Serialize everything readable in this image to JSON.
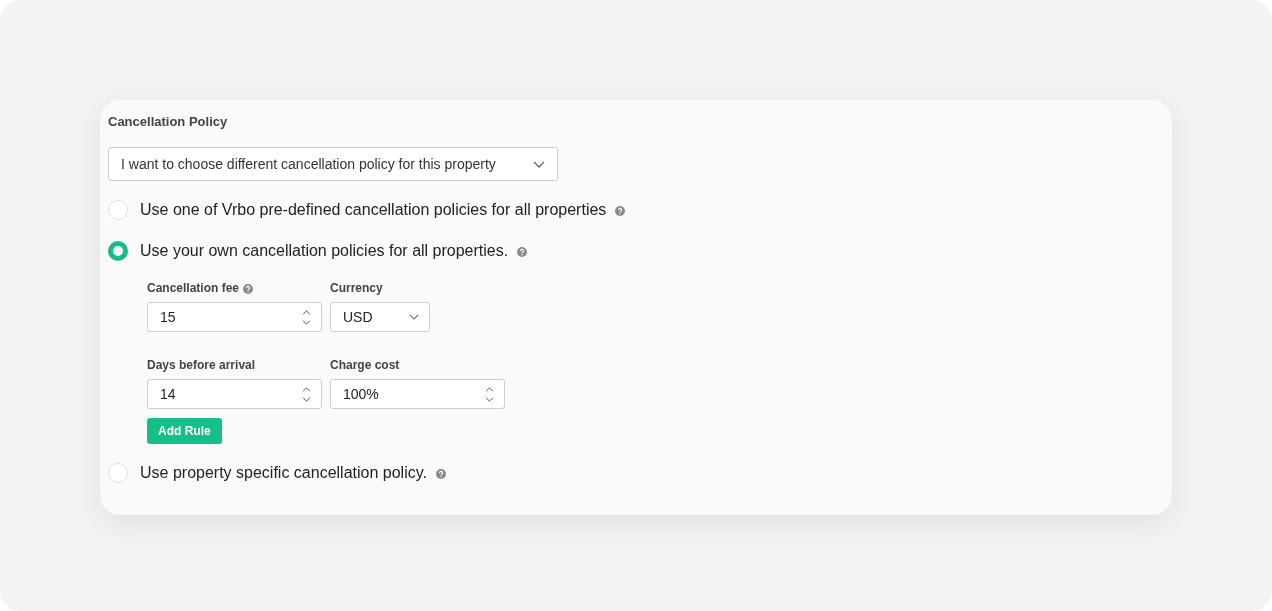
{
  "section": {
    "title": "Cancellation Policy"
  },
  "policy_select": {
    "value": "I want to choose different cancellation policy for this property"
  },
  "options": [
    {
      "label": "Use one of Vrbo pre-defined cancellation policies for all properties",
      "selected": false
    },
    {
      "label": "Use your own cancellation policies for all properties.",
      "selected": true,
      "rows": [
        [
          {
            "label": "Cancellation fee",
            "kind": "number",
            "value": "15",
            "help": true
          },
          {
            "label": "Currency",
            "kind": "select",
            "value": "USD",
            "help": false
          }
        ],
        [
          {
            "label": "Days before arrival",
            "kind": "number",
            "value": "14",
            "help": false
          },
          {
            "label": "Charge cost",
            "kind": "number",
            "value": "100%",
            "help": false
          }
        ]
      ],
      "button": "Add Rule"
    },
    {
      "label": "Use property specific cancellation policy.",
      "selected": false
    }
  ]
}
